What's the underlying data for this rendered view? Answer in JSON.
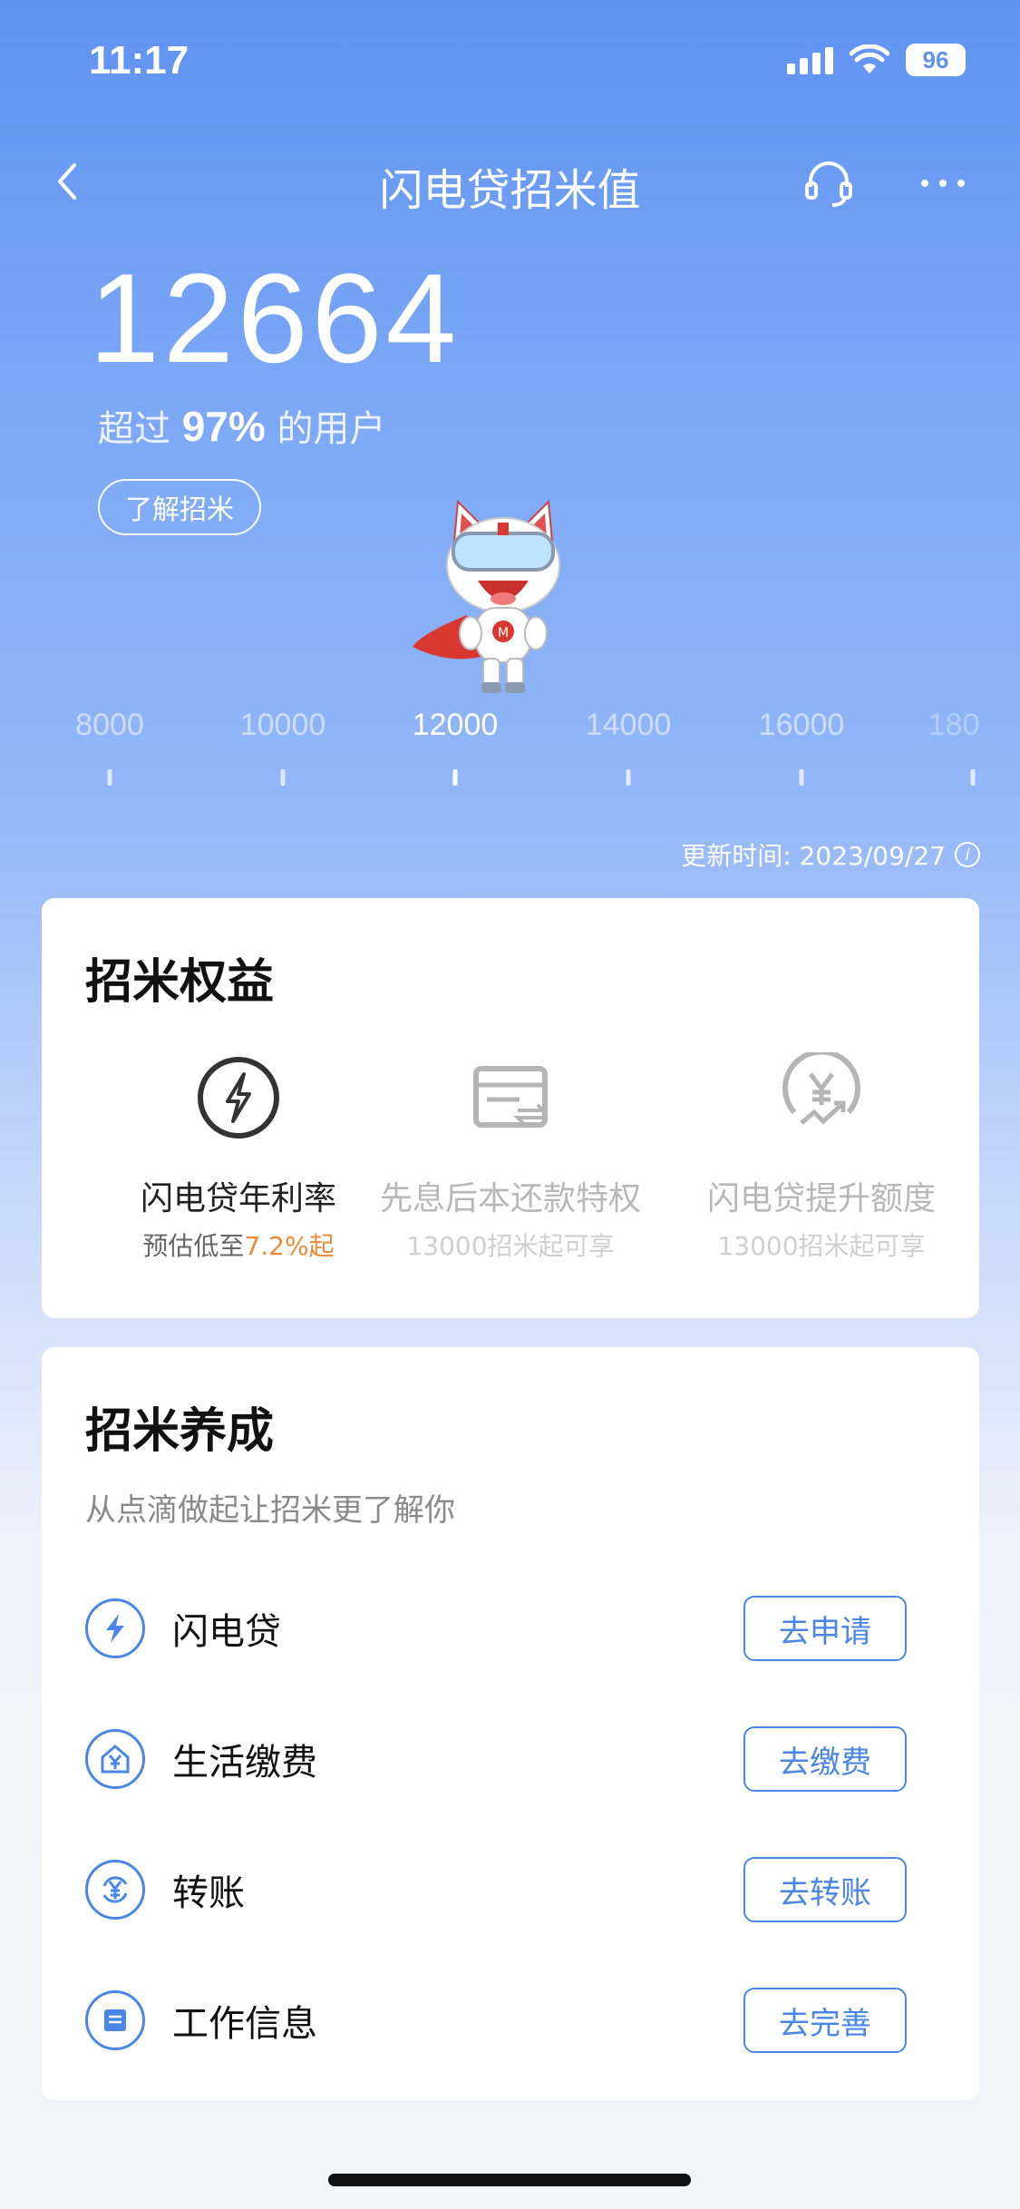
{
  "status_bar": {
    "time": "11:17",
    "battery": "96"
  },
  "nav": {
    "title": "闪电贷招米值"
  },
  "score": {
    "value": "12664",
    "exceed_prefix": "超过",
    "exceed_pct": "97%",
    "exceed_suffix": "的用户",
    "learn_label": "了解招米"
  },
  "scale": {
    "ticks": [
      "8000",
      "10000",
      "12000",
      "14000",
      "16000",
      "180"
    ],
    "active": "12000"
  },
  "update_time": "更新时间: 2023/09/27",
  "benefits": {
    "title": "招米权益",
    "items": [
      {
        "name": "闪电贷年利率",
        "sub_prefix": "预估低至",
        "sub_highlight": "7.2%起",
        "icon": "lightning-circle-icon"
      },
      {
        "name": "先息后本还款特权",
        "sub": "13000招米起可享",
        "icon": "card-transfer-icon"
      },
      {
        "name": "闪电贷提升额度",
        "sub": "13000招米起可享",
        "icon": "yuan-growth-icon"
      }
    ],
    "highlight_color": "#f0883a"
  },
  "cultivate": {
    "title": "招米养成",
    "subtitle": "从点滴做起让招米更了解你",
    "tasks": [
      {
        "label": "闪电贷",
        "button": "去申请",
        "icon": "lightning-icon"
      },
      {
        "label": "生活缴费",
        "button": "去缴费",
        "icon": "home-yuan-icon"
      },
      {
        "label": "转账",
        "button": "去转账",
        "icon": "transfer-yuan-icon"
      },
      {
        "label": "工作信息",
        "button": "去完善",
        "icon": "document-icon"
      }
    ],
    "accent_color": "#4a86e8"
  }
}
